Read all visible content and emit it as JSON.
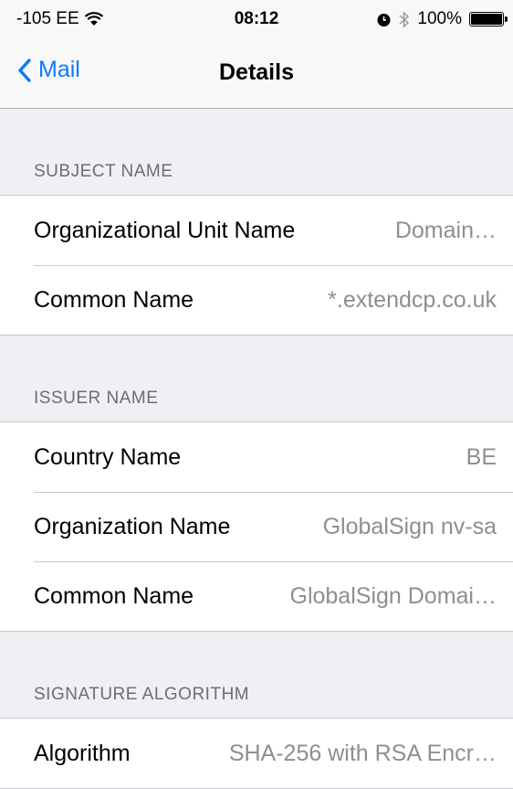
{
  "status_bar": {
    "carrier": "-105 EE",
    "time": "08:12",
    "battery": "100%",
    "battery_level": 1.0
  },
  "nav": {
    "back_label": "Mail",
    "title": "Details"
  },
  "sections": [
    {
      "header": "SUBJECT NAME",
      "rows": [
        {
          "key": "Organizational Unit Name",
          "value": "Domain…"
        },
        {
          "key": "Common Name",
          "value": "*.extendcp.co.uk"
        }
      ]
    },
    {
      "header": "ISSUER NAME",
      "rows": [
        {
          "key": "Country Name",
          "value": "BE"
        },
        {
          "key": "Organization Name",
          "value": "GlobalSign nv-sa"
        },
        {
          "key": "Common Name",
          "value": "GlobalSign Domai…"
        }
      ]
    },
    {
      "header": "SIGNATURE ALGORITHM",
      "rows": [
        {
          "key": "Algorithm",
          "value": "SHA-256 with RSA Encr…"
        }
      ]
    }
  ],
  "colors": {
    "accent": "#0a7aff",
    "background": "#efeff4",
    "secondary_text": "#8e8e93"
  }
}
